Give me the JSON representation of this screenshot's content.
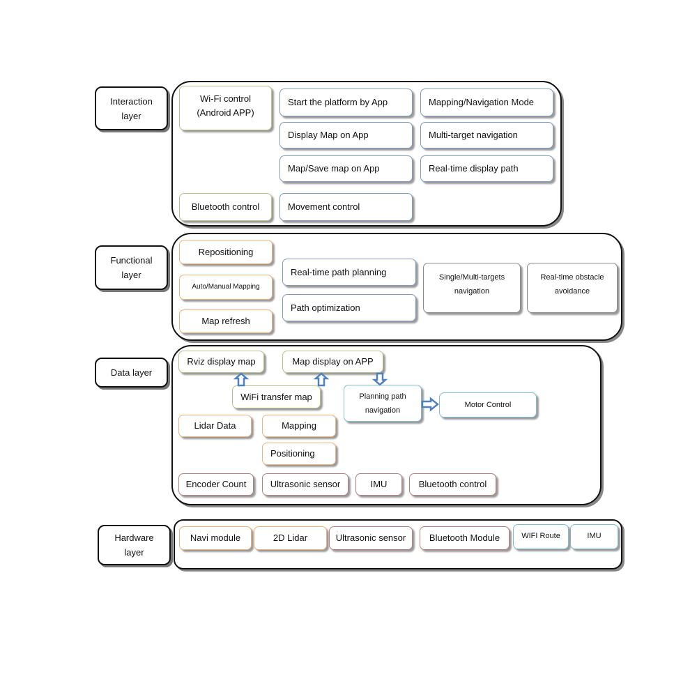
{
  "colors": {
    "green": "#b5c48a",
    "blue": "#7f9cc0",
    "orange": "#efb27a",
    "red": "#b88080",
    "cyan": "#7fbcd0",
    "gray": "#8a8a8a",
    "arrow": "#4f81bd"
  },
  "layers": {
    "interaction": {
      "label": "Interaction\nlayer",
      "items": [
        "Wi-Fi control\n(Android APP)",
        "Start the platform by App",
        "Display Map on App",
        "Map/Save map on App",
        "Mapping/Navigation Mode",
        "Multi-target navigation",
        "Real-time display path",
        "Bluetooth control",
        "Movement control"
      ]
    },
    "functional": {
      "label": "Functional\nlayer",
      "items": [
        "Repositioning",
        "Auto/Manual Mapping",
        "Map refresh",
        "Real-time path planning",
        "Path optimization",
        "Single/Multi-targets\nnavigation",
        "Real-time obstacle\navoidance"
      ]
    },
    "data": {
      "label": "Data layer",
      "items": [
        "Rviz display map",
        "Map display on APP",
        "WiFi transfer map",
        "Planning path\nnavigation",
        "Motor Control",
        "Lidar Data",
        "Mapping",
        "Positioning",
        "Encoder Count",
        "Ultrasonic sensor",
        "IMU",
        "Bluetooth control"
      ]
    },
    "hardware": {
      "label": "Hardware\nlayer",
      "items": [
        "Navi module",
        "2D Lidar",
        "Ultrasonic sensor",
        "Bluetooth Module",
        "WIFI Route",
        "IMU"
      ]
    }
  }
}
